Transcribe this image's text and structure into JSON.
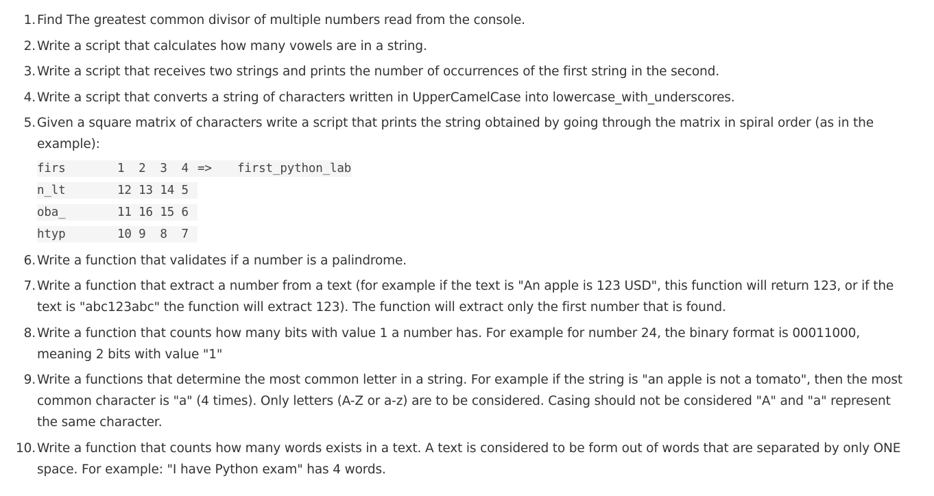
{
  "exercises": [
    {
      "num": "1.",
      "text": "Find The greatest common divisor of multiple numbers read from the console."
    },
    {
      "num": "2.",
      "text": "Write a script that calculates how many vowels are in a string."
    },
    {
      "num": "3.",
      "text": "Write a script that receives two strings and prints the number of occurrences of the first string in the second."
    },
    {
      "num": "4.",
      "text": "Write a script that converts a string of characters written in UpperCamelCase into lowercase_with_underscores."
    },
    {
      "num": "5.",
      "text": "Given a square matrix of characters write a script that prints the string obtained by going through the matrix in spiral order (as in the example):"
    },
    {
      "num": "6.",
      "text": "Write a function that validates if a number is a palindrome."
    },
    {
      "num": "7.",
      "text": "Write a function that extract a number from a text (for example if the text is \"An apple is 123 USD\", this function will return 123, or if the text is \"abc123abc\" the function will extract 123). The function will extract only the first number that is found."
    },
    {
      "num": "8.",
      "text": "Write a function that counts how many bits with value 1 a number has. For example for number 24, the binary format is 00011000, meaning 2 bits with value \"1\""
    },
    {
      "num": "9.",
      "text": "Write a functions that determine the most common letter in a string. For example if the string is \"an apple is not a tomato\", then the most common character is \"a\" (4 times). Only letters (A-Z or a-z) are to be considered. Casing should not be considered \"A\" and \"a\" represent the same character."
    },
    {
      "num": "10.",
      "text": "Write a function that counts how many words exists in a text. A text is considered to be form out of words that are separated by only ONE space. For example: \"I have Python exam\" has 4 words."
    }
  ],
  "spiral_example": {
    "rows": [
      {
        "word": "firs",
        "nums": "1  2  3  4",
        "arrow": "=>",
        "result": "first_python_lab"
      },
      {
        "word": "n_lt",
        "nums": "12 13 14 5"
      },
      {
        "word": "oba_",
        "nums": "11 16 15 6"
      },
      {
        "word": "htyp",
        "nums": "10 9  8  7"
      }
    ]
  }
}
